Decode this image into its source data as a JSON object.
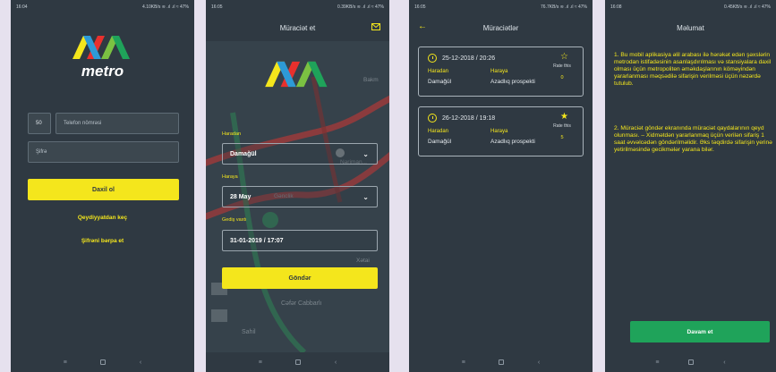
{
  "status": {
    "s1": {
      "time": "16:04",
      "right": "4.10KB/s ≋ .ıl .ıl ≈ 47%"
    },
    "s2": {
      "time": "16:05",
      "right": "0.39KB/s ≋ .ıl .ıl ≈ 47%"
    },
    "s3": {
      "time": "16:05",
      "right": "76.7KB/s ≋ .ıl .ıl ≈ 47%"
    },
    "s4": {
      "time": "16:08",
      "right": "0.45KB/s ≋ .ıl .ıl ≈ 47%"
    }
  },
  "nav": {
    "menu": "≡",
    "home": "",
    "back": "‹"
  },
  "login": {
    "logo_text": "metro",
    "country_code": "50",
    "phone_placeholder": "Telefon nömrəsi",
    "password_placeholder": "Şifrə",
    "login_button": "Daxil ol",
    "register_link": "Qeydiyyatdan keç",
    "reset_link": "Şifrəni bərpa et"
  },
  "request": {
    "title": "Müraciət et",
    "mail_icon": "envelope-icon",
    "from_label": "Haradan",
    "from_value": "Damağül",
    "to_label": "Haraya",
    "to_value": "28 May",
    "time_label": "Gediş vaxtı",
    "time_value": "31-01-2019 / 17:07",
    "send_button": "Göndər",
    "map_labels": {
      "bakm": "Bakm",
      "nerimanov": "Nəriman...",
      "genclik": "Gənclik",
      "xatai": "Xətai",
      "cafar": "Cəfər Cabbarlı",
      "sahil": "Sahil"
    }
  },
  "requests": {
    "title": "Müraciətlər",
    "back_icon": "arrow-left-icon",
    "cards": [
      {
        "date": "25-12-2018 / 20:26",
        "from_h": "Haradan",
        "to_h": "Haraya",
        "from": "Damağül",
        "to": "Azadlıq prospekti",
        "rate_label": "Rate this",
        "rate": "0",
        "star": "☆"
      },
      {
        "date": "26-12-2018 / 19:18",
        "from_h": "Haradan",
        "to_h": "Haraya",
        "from": "Damağül",
        "to": "Azadlıq prospekti",
        "rate_label": "Rate this",
        "rate": "5",
        "star": "★"
      }
    ]
  },
  "info": {
    "title": "Məlumat",
    "p1": "1. Bu mobil aplikasiya əlil arabası ilə hərəkət edən şəxslərin metrodan istifadəsinin asanlaşdırılması və stansiyalara daxil olması üçün metropoliten əməkdaşlarının köməyindən yararlanması məqsədilə sifarişin verilməsi üçün nəzərdə tutulub.",
    "p2": "2. Müraciət göndər ekranında müraciət qaydalarının qeyd olunması. – Xidmətdən yararlanmaq üçün verilən sifariş 1 saat əvvəlcədən göndərilməlidir. Əks təqdirdə sifarişin yerinə yetirilməsində gecikmələr yarana bilər.",
    "continue_button": "Davam et"
  },
  "colors": {
    "bg": "#2f3942",
    "accent": "#f4e61c",
    "green": "#1fa35a"
  }
}
